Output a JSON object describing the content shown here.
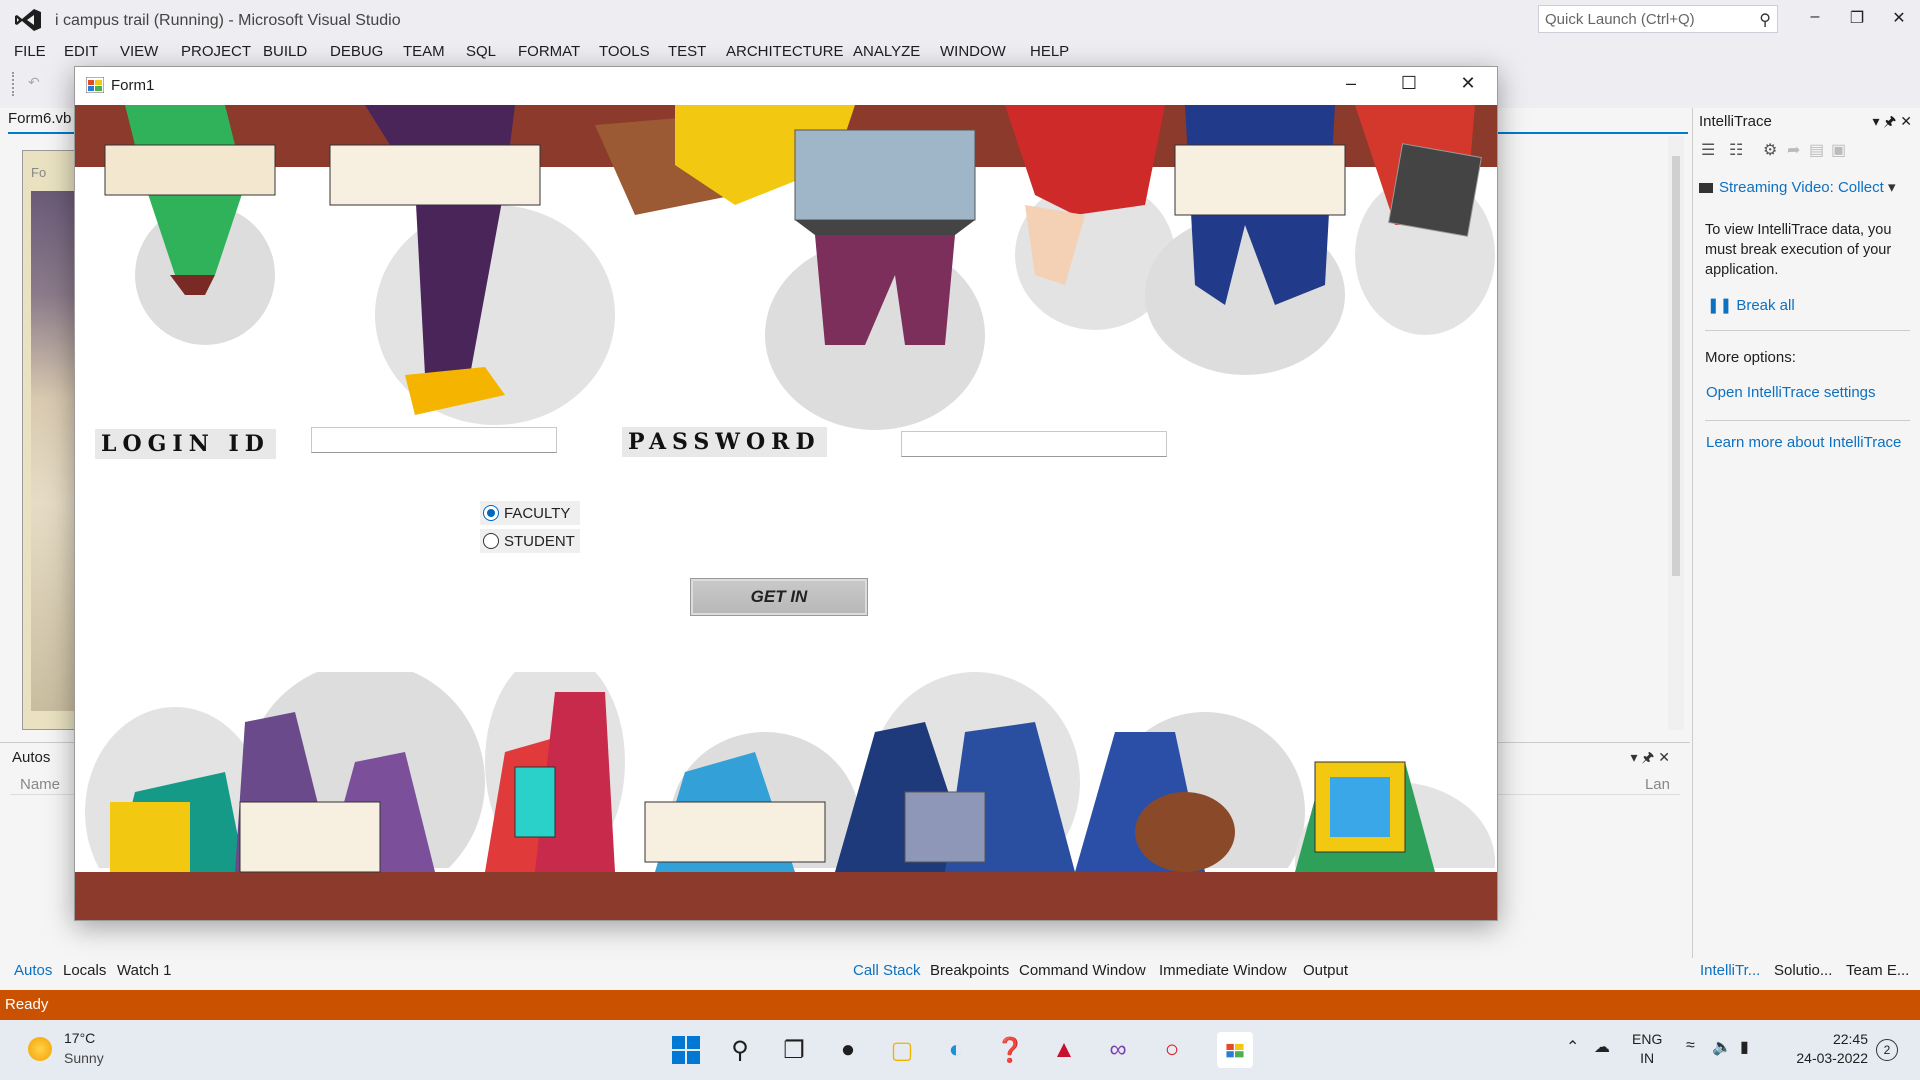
{
  "vs": {
    "title": "i campus trail (Running) - Microsoft Visual Studio",
    "quick_launch_placeholder": "Quick Launch (Ctrl+Q)",
    "menu": [
      "FILE",
      "EDIT",
      "VIEW",
      "PROJECT",
      "BUILD",
      "DEBUG",
      "TEAM",
      "SQL",
      "FORMAT",
      "TOOLS",
      "TEST",
      "ARCHITECTURE",
      "ANALYZE",
      "WINDOW",
      "HELP"
    ],
    "doc_tab": "Form6.vb",
    "designer_tab": "Fo",
    "autos": {
      "title": "Autos",
      "col_name": "Name",
      "col_lang": "Lan"
    },
    "bottom_tabs_left": [
      "Autos",
      "Locals",
      "Watch 1"
    ],
    "bottom_tabs_mid": [
      "Call Stack",
      "Breakpoints",
      "Command Window",
      "Immediate Window",
      "Output"
    ],
    "bottom_tabs_right": [
      "IntelliTr...",
      "Solutio...",
      "Team E..."
    ],
    "status": "Ready",
    "intellitrace": {
      "title": "IntelliTrace",
      "streaming": "Streaming Video: Collect",
      "message": "To view IntelliTrace data, you must break execution of your application.",
      "break_all": "Break all",
      "more_options": "More options:",
      "open_settings": "Open IntelliTrace settings",
      "learn_more": "Learn more about IntelliTrace"
    }
  },
  "form1": {
    "title": "Form1",
    "login_label": "LOGIN ID",
    "password_label": "PASSWORD",
    "login_value": "",
    "password_value": "",
    "radio_faculty": "FACULTY",
    "radio_student": "STUDENT",
    "selected_role": "FACULTY",
    "button": "GET IN"
  },
  "taskbar": {
    "temperature": "17°C",
    "condition": "Sunny",
    "lang_top": "ENG",
    "lang_bottom": "IN",
    "time": "22:45",
    "date": "24-03-2022",
    "notifications": "2"
  },
  "colors": {
    "accent": "#007acc",
    "status_bar": "#ca5100",
    "link": "#0e70c0"
  }
}
